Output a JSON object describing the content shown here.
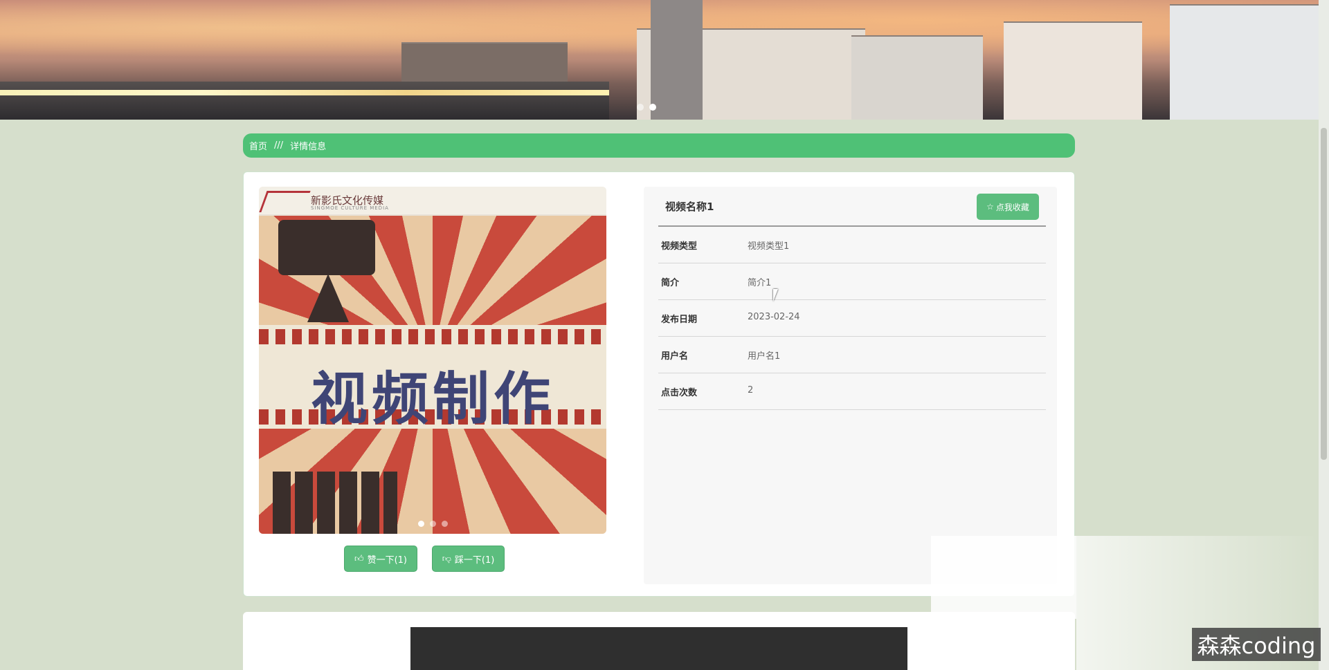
{
  "breadcrumb": {
    "home": "首页",
    "separator": "///",
    "current": "详情信息"
  },
  "poster": {
    "logo_text": "新影氏文化传媒",
    "logo_sub": "SINGMOE CULTURE MEDIA",
    "title": "视频制作"
  },
  "actions": {
    "like": "赞一下(1)",
    "dislike": "踩一下(1)",
    "like_icon": "thumbs-up-icon",
    "dislike_icon": "thumbs-down-icon"
  },
  "detail": {
    "name": "视频名称1",
    "favorite_label": "点我收藏",
    "favorite_icon": "star-icon",
    "fields": [
      {
        "label": "视频类型",
        "value": "视频类型1"
      },
      {
        "label": "简介",
        "value": "简介1"
      },
      {
        "label": "发布日期",
        "value": "2023-02-24"
      },
      {
        "label": "用户名",
        "value": "用户名1"
      },
      {
        "label": "点击次数",
        "value": "2"
      }
    ]
  },
  "watermark": "森森coding",
  "colors": {
    "accent": "#4fc176",
    "button": "#5cbd7e",
    "page_bg": "#d6dfcc"
  }
}
